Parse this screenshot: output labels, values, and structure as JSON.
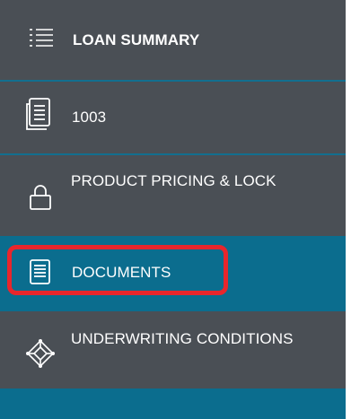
{
  "sidebar": {
    "items": [
      {
        "label": "LOAN SUMMARY",
        "icon": "list-icon"
      },
      {
        "label": "1003",
        "icon": "form-icon"
      },
      {
        "label": "PRODUCT PRICING & LOCK",
        "icon": "lock-icon"
      },
      {
        "label": "DOCUMENTS",
        "icon": "document-icon",
        "active": true
      },
      {
        "label": "UNDERWRITING CONDITIONS",
        "icon": "diamond-network-icon"
      }
    ]
  },
  "colors": {
    "sidebar_bg": "#4a4f55",
    "active_bg": "#0b6d8e",
    "divider": "#126f8f",
    "highlight": "#e8262c"
  }
}
